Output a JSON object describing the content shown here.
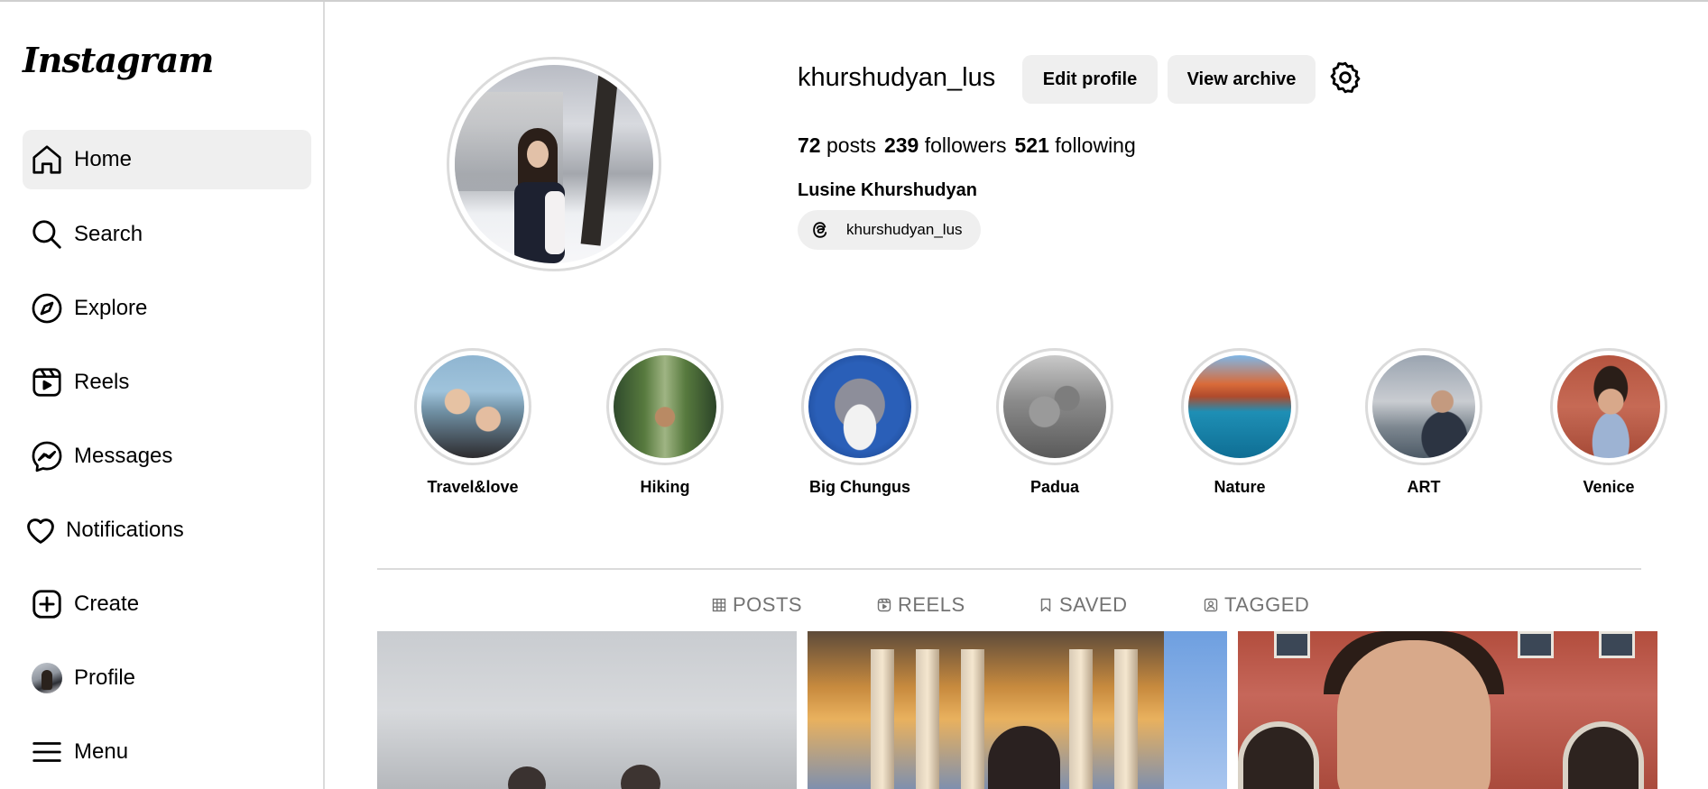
{
  "app": {
    "logo_text": "Instagram"
  },
  "sidebar": {
    "items": [
      {
        "label": "Home",
        "icon": "home-icon",
        "active": true
      },
      {
        "label": "Search",
        "icon": "search-icon"
      },
      {
        "label": "Explore",
        "icon": "compass-icon"
      },
      {
        "label": "Reels",
        "icon": "reels-icon"
      },
      {
        "label": "Messages",
        "icon": "messenger-icon"
      },
      {
        "label": "Notifications",
        "icon": "heart-icon"
      },
      {
        "label": "Create",
        "icon": "plus-square-icon"
      },
      {
        "label": "Profile",
        "icon": "avatar"
      },
      {
        "label": "Menu",
        "icon": "hamburger-icon"
      }
    ]
  },
  "profile": {
    "username": "khurshudyan_lus",
    "edit_label": "Edit profile",
    "archive_label": "View archive",
    "stats": {
      "posts_count": "72",
      "posts_label": "posts",
      "followers_count": "239",
      "followers_label": "followers",
      "following_count": "521",
      "following_label": "following"
    },
    "full_name": "Lusine Khurshudyan",
    "threads_handle": "khurshudyan_lus"
  },
  "highlights": [
    {
      "label": "Travel&love"
    },
    {
      "label": "Hiking"
    },
    {
      "label": "Big Chungus"
    },
    {
      "label": "Padua"
    },
    {
      "label": "Nature"
    },
    {
      "label": "ART"
    },
    {
      "label": "Venice"
    }
  ],
  "tabs": [
    {
      "label": "POSTS",
      "icon": "grid-icon"
    },
    {
      "label": "REELS",
      "icon": "reels-icon"
    },
    {
      "label": "SAVED",
      "icon": "bookmark-icon"
    },
    {
      "label": "TAGGED",
      "icon": "tag-user-icon"
    }
  ],
  "colors": {
    "active_bg": "#efefef",
    "button_bg": "#efefef",
    "border": "#dbdbdb",
    "muted_text": "#737373"
  }
}
